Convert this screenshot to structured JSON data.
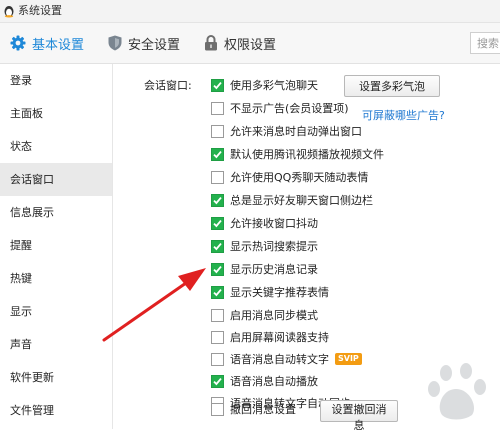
{
  "window": {
    "title": "系统设置"
  },
  "tabs": [
    {
      "label": "基本设置",
      "active": true,
      "icon": "gear-icon"
    },
    {
      "label": "安全设置",
      "active": false,
      "icon": "shield-icon"
    },
    {
      "label": "权限设置",
      "active": false,
      "icon": "lock-icon"
    }
  ],
  "search": {
    "placeholder": "搜索"
  },
  "sidebar": {
    "items": [
      {
        "label": "登录"
      },
      {
        "label": "主面板"
      },
      {
        "label": "状态"
      },
      {
        "label": "会话窗口",
        "active": true
      },
      {
        "label": "信息展示"
      },
      {
        "label": "提醒"
      },
      {
        "label": "热键"
      },
      {
        "label": "显示"
      },
      {
        "label": "声音"
      },
      {
        "label": "软件更新"
      },
      {
        "label": "文件管理"
      }
    ]
  },
  "main": {
    "section_label": "会话窗口:",
    "options": [
      {
        "label": "使用多彩气泡聊天",
        "checked": true
      },
      {
        "label": "不显示广告(会员设置项)",
        "checked": false
      },
      {
        "label": "允许来消息时自动弹出窗口",
        "checked": false
      },
      {
        "label": "默认使用腾讯视频播放视频文件",
        "checked": true
      },
      {
        "label": "允许使用QQ秀聊天随动表情",
        "checked": false
      },
      {
        "label": "总是显示好友聊天窗口侧边栏",
        "checked": true
      },
      {
        "label": "允许接收窗口抖动",
        "checked": true
      },
      {
        "label": "显示热词搜索提示",
        "checked": true
      },
      {
        "label": "显示历史消息记录",
        "checked": true
      },
      {
        "label": "显示关键字推荐表情",
        "checked": true
      },
      {
        "label": "启用消息同步模式",
        "checked": false
      },
      {
        "label": "启用屏幕阅读器支持",
        "checked": false
      },
      {
        "label": "语音消息自动转文字",
        "checked": false
      },
      {
        "label": "语音消息自动播放",
        "checked": true
      },
      {
        "label": "语音消息转文字自动同步",
        "checked": false
      },
      {
        "label": "撤回消息设置",
        "checked": false
      }
    ],
    "bubble_button": "设置多彩气泡",
    "ad_link": "可屏蔽哪些广告?",
    "svip_badge": "SVIP",
    "recall_button": "设置撤回消息"
  },
  "colors": {
    "accent": "#1e88d8",
    "check_green": "#23b14d",
    "arrow_red": "#e02020",
    "link": "#1f78d1"
  }
}
